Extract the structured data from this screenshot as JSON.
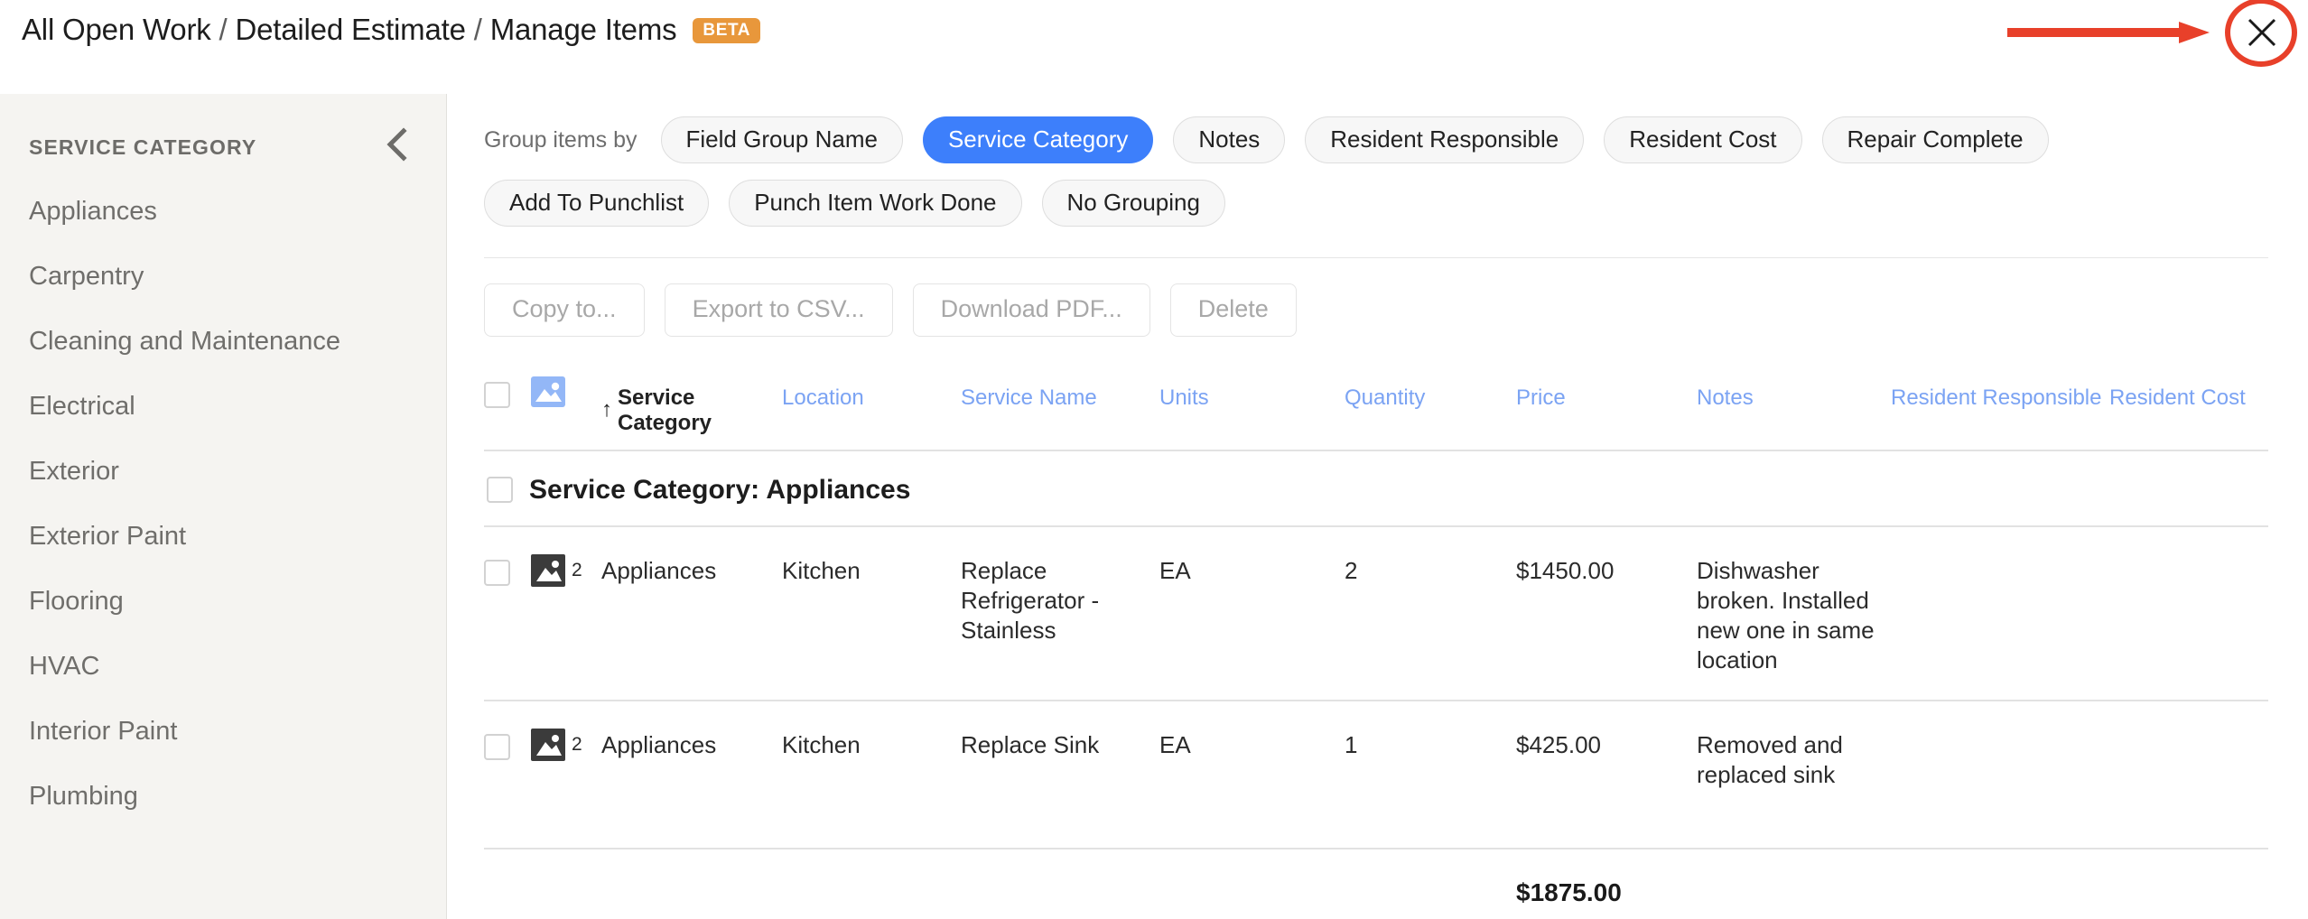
{
  "header": {
    "breadcrumb": [
      "All Open Work",
      "Detailed Estimate",
      "Manage Items"
    ],
    "separator": "/",
    "beta_badge": "BETA",
    "close_icon": "close-icon",
    "annotation_color": "#e8402a"
  },
  "sidebar": {
    "title": "SERVICE CATEGORY",
    "collapse_icon": "chevron-left-icon",
    "items": [
      {
        "label": "Appliances"
      },
      {
        "label": "Carpentry"
      },
      {
        "label": "Cleaning and Maintenance"
      },
      {
        "label": "Electrical"
      },
      {
        "label": "Exterior"
      },
      {
        "label": "Exterior Paint"
      },
      {
        "label": "Flooring"
      },
      {
        "label": "HVAC"
      },
      {
        "label": "Interior Paint"
      },
      {
        "label": "Plumbing"
      }
    ]
  },
  "group_by": {
    "label": "Group items by",
    "active": "Service Category",
    "options": [
      {
        "label": "Field Group Name",
        "active": false
      },
      {
        "label": "Service Category",
        "active": true
      },
      {
        "label": "Notes",
        "active": false
      },
      {
        "label": "Resident Responsible",
        "active": false
      },
      {
        "label": "Resident Cost",
        "active": false
      },
      {
        "label": "Repair Complete",
        "active": false
      },
      {
        "label": "Add To Punchlist",
        "active": false
      },
      {
        "label": "Punch Item Work Done",
        "active": false
      },
      {
        "label": "No Grouping",
        "active": false
      }
    ]
  },
  "actions": [
    {
      "label": "Copy to...",
      "disabled": true
    },
    {
      "label": "Export to CSV...",
      "disabled": true
    },
    {
      "label": "Download PDF...",
      "disabled": true
    },
    {
      "label": "Delete",
      "disabled": true
    }
  ],
  "table": {
    "columns": [
      {
        "key": "select",
        "label": ""
      },
      {
        "key": "image",
        "label": ""
      },
      {
        "key": "service_category",
        "label": "Service Category",
        "sorted": true,
        "sort_dir": "asc",
        "sort_glyph": "↑"
      },
      {
        "key": "location",
        "label": "Location"
      },
      {
        "key": "service_name",
        "label": "Service Name"
      },
      {
        "key": "units",
        "label": "Units"
      },
      {
        "key": "quantity",
        "label": "Quantity"
      },
      {
        "key": "price",
        "label": "Price"
      },
      {
        "key": "notes",
        "label": "Notes"
      },
      {
        "key": "resident_responsible",
        "label": "Resident Responsible"
      },
      {
        "key": "resident_cost",
        "label": "Resident Cost"
      }
    ],
    "group": {
      "title": "Service Category: Appliances"
    },
    "rows": [
      {
        "image_count": "2",
        "service_category": "Appliances",
        "location": "Kitchen",
        "service_name": "Replace Refrigerator - Stainless",
        "units": "EA",
        "quantity": "2",
        "price": "$1450.00",
        "notes": "Dishwasher broken. Installed new one in same location",
        "resident_responsible": "",
        "resident_cost": ""
      },
      {
        "image_count": "2",
        "service_category": "Appliances",
        "location": "Kitchen",
        "service_name": "Replace Sink",
        "units": "EA",
        "quantity": "1",
        "price": "$425.00",
        "notes": "Removed and replaced sink",
        "resident_responsible": "",
        "resident_cost": ""
      }
    ],
    "totals": {
      "price": "$1875.00"
    }
  },
  "colors": {
    "accent_blue": "#3d7ffb",
    "link_blue": "#7ba3f3",
    "beta_orange": "#e8973b",
    "annotation_red": "#e8402a",
    "sidebar_bg": "#f5f4f1"
  }
}
